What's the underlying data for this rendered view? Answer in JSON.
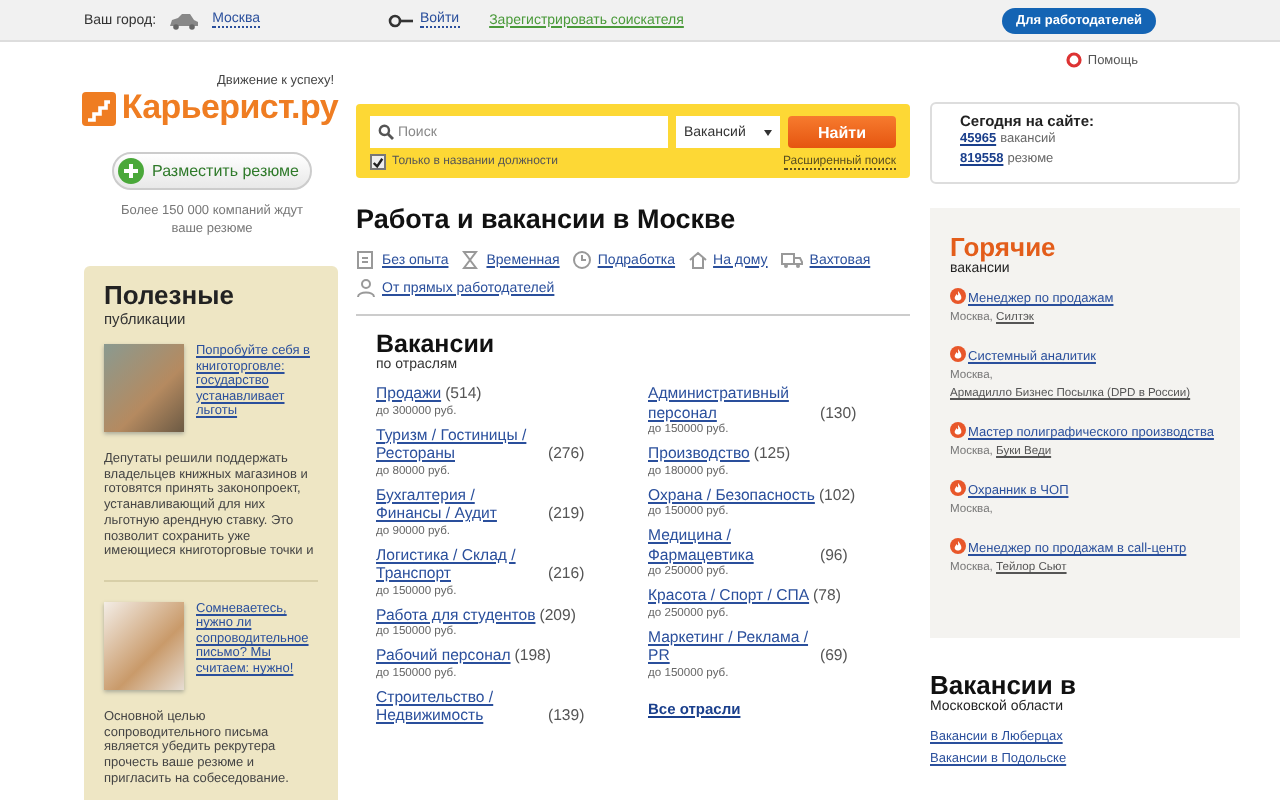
{
  "top_bar": {
    "city_label": "Ваш город:",
    "city": "Москва",
    "login": "Войти",
    "register": "Зарегистрировать соискателя",
    "employers_button": "Для работодателей"
  },
  "help": "Помощь",
  "logo": {
    "slogan": "Движение к успеху!",
    "name": "Карьерист.ру"
  },
  "post_resume_button": "Разместить резюме",
  "companies_note": "Более 150 000 компаний ждут ваше резюме",
  "publications": {
    "title": "Полезные",
    "subtitle": "публикации",
    "articles": [
      {
        "link": "Попробуйте себя в книготорговле: государство устанавливает льготы",
        "text": "Депутаты решили поддержать владельцев книжных магазинов и готовятся принять законопроект, устанавливающий для них льготную арендную ставку. Это позволит сохранить уже имеющиеся книготорговые точки и"
      },
      {
        "link": "Сомневаетесь, нужно ли сопроводительное письмо? Мы считаем: нужно!",
        "text": "Основной целью сопроводительного письма является убедить рекрутера прочесть ваше резюме и пригласить на собеседование."
      }
    ]
  },
  "search": {
    "placeholder": "Поиск",
    "type": "Вакансий",
    "button": "Найти",
    "only_titles": {
      "label": "Только в названии должности",
      "checked": true
    },
    "advanced": "Расширенный поиск"
  },
  "heading": "Работа и вакансии в Москве",
  "quick_links": [
    "Без опыта",
    "Временная",
    "Подработка",
    "На дому",
    "Вахтовая",
    "От прямых работодателей"
  ],
  "industries": {
    "title": "Вакансии",
    "subtitle": "по отраслям",
    "columns": [
      [
        {
          "name": "Продажи",
          "count": "(514)",
          "salary": "до 300000 руб."
        },
        {
          "name": "Туризм / Гостиницы / Рестораны",
          "count": "(276)",
          "salary": "до 80000 руб."
        },
        {
          "name": "Бухгалтерия / Финансы / Аудит",
          "count": "(219)",
          "salary": "до 90000 руб."
        },
        {
          "name": "Логистика / Склад / Транспорт",
          "count": "(216)",
          "salary": "до 150000 руб."
        },
        {
          "name": "Работа для студентов",
          "count": "(209)",
          "salary": "до 150000 руб."
        },
        {
          "name": "Рабочий персонал",
          "count": "(198)",
          "salary": "до 150000 руб."
        },
        {
          "name": "Строительство / Недвижимость",
          "count": "(139)"
        }
      ],
      [
        {
          "name": "Административный персонал",
          "count": "(130)",
          "salary": "до 150000 руб."
        },
        {
          "name": "Производство",
          "count": "(125)",
          "salary": "до 180000 руб."
        },
        {
          "name": "Охрана / Безопасность",
          "count": "(102)",
          "salary": "до 150000 руб."
        },
        {
          "name": "Медицина / Фармацевтика",
          "count": "(96)",
          "salary": "до 250000 руб."
        },
        {
          "name": "Красота / Спорт / СПА",
          "count": "(78)",
          "salary": "до 250000 руб."
        },
        {
          "name": "Маркетинг / Реклама / PR",
          "count": "(69)",
          "salary": "до 150000 руб."
        }
      ]
    ],
    "all_link": "Все отрасли"
  },
  "today": {
    "title": "Сегодня на сайте:",
    "stats": [
      {
        "count": "45965",
        "unit": "вакансий"
      },
      {
        "count": "819558",
        "unit": "резюме"
      }
    ]
  },
  "hot": {
    "title": "Горячие",
    "subtitle": "вакансии",
    "jobs": [
      {
        "title": "Менеджер по продажам",
        "city": "Москва,",
        "company": "Силтэк"
      },
      {
        "title": "Системный аналитик",
        "city": "Москва,",
        "company": "Армадилло Бизнес Посылка (DPD в России)"
      },
      {
        "title": "Мастер полиграфического производства",
        "city": "Москва,",
        "company": "Буки Веди"
      },
      {
        "title": "Охранник в ЧОП",
        "city": "Москва,"
      },
      {
        "title": "Менеджер по продажам в call-центр",
        "city": "Москва,",
        "company": "Тейлор Сьют"
      }
    ]
  },
  "region": {
    "title": "Вакансии в",
    "subtitle": "Московской области",
    "links": [
      "Вакансии в Люберцах",
      "Вакансии в Подольске"
    ]
  }
}
